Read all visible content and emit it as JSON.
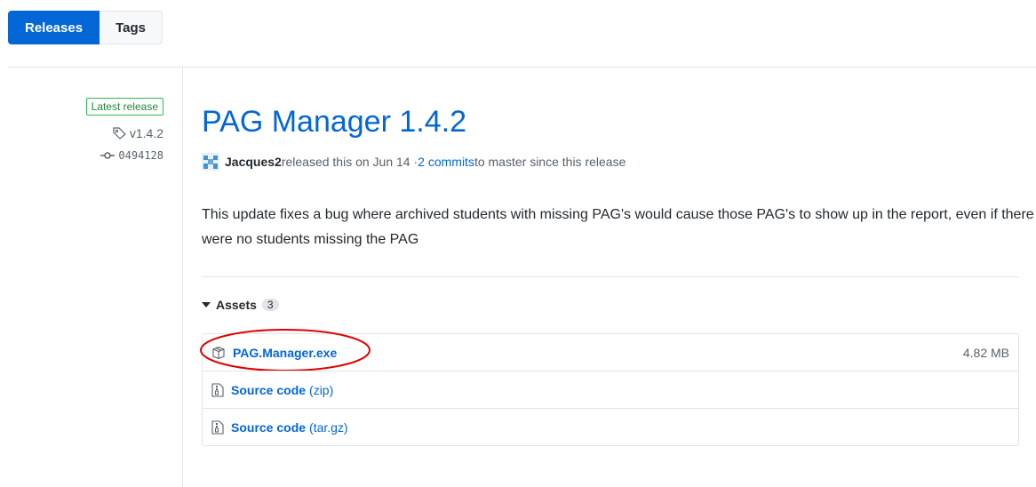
{
  "tabs": {
    "releases": "Releases",
    "tags": "Tags"
  },
  "sidebar": {
    "badge": "Latest release",
    "tag": "v1.4.2",
    "commit": "0494128"
  },
  "release": {
    "title": "PAG Manager 1.4.2",
    "author": "Jacques2",
    "released_text": " released this on Jun 14 · ",
    "commits_link": "2 commits",
    "commits_suffix": " to master since this release",
    "description": "This update fixes a bug where archived students with missing PAG's would cause those PAG's to show up in the report, even if there were no students missing the PAG"
  },
  "assets": {
    "label": "Assets",
    "count": "3",
    "items": [
      {
        "name": "PAG.Manager.exe",
        "format": "",
        "size": "4.82 MB",
        "icon": "package-icon"
      },
      {
        "name": "Source code",
        "format": "(zip)",
        "size": "",
        "icon": "file-zip-icon"
      },
      {
        "name": "Source code",
        "format": "(tar.gz)",
        "size": "",
        "icon": "file-zip-icon"
      }
    ]
  },
  "colors": {
    "accent": "#0366d6",
    "highlight_ring": "#e00000",
    "badge_green": "#2cbe4e"
  }
}
